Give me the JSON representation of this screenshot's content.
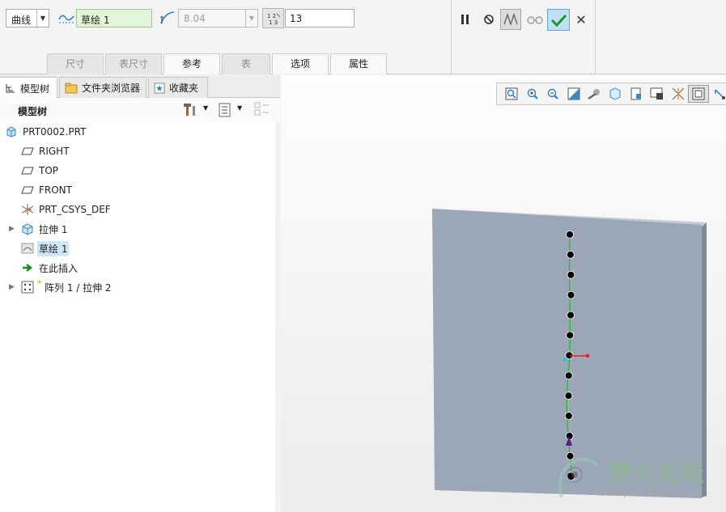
{
  "dashboard": {
    "type_dropdown": "曲线",
    "sketch_field": "草绘 1",
    "spacing_value": "8.04",
    "count_value": "13",
    "tabs": [
      {
        "label": "尺寸",
        "active": false
      },
      {
        "label": "表尺寸",
        "active": false
      },
      {
        "label": "参考",
        "active": true
      },
      {
        "label": "表",
        "active": false
      },
      {
        "label": "选项",
        "active": true
      },
      {
        "label": "属性",
        "active": true
      }
    ],
    "controls": [
      "pause-icon",
      "cancel-preview-icon",
      "verify-icon",
      "glasses-icon",
      "ok-check-icon",
      "close-icon"
    ]
  },
  "navigator": {
    "tabs": [
      {
        "label": "模型树"
      },
      {
        "label": "文件夹浏览器"
      },
      {
        "label": "收藏夹"
      }
    ],
    "tree_title": "模型树",
    "items": [
      {
        "label": "PRT0002.PRT",
        "icon": "part-icon",
        "indent": 0,
        "expander": false
      },
      {
        "label": "RIGHT",
        "icon": "datum-plane-icon",
        "indent": 1,
        "expander": false
      },
      {
        "label": "TOP",
        "icon": "datum-plane-icon",
        "indent": 1,
        "expander": false
      },
      {
        "label": "FRONT",
        "icon": "datum-plane-icon",
        "indent": 1,
        "expander": false
      },
      {
        "label": "PRT_CSYS_DEF",
        "icon": "csys-icon",
        "indent": 1,
        "expander": false
      },
      {
        "label": "拉伸 1",
        "icon": "extrude-icon",
        "indent": 1,
        "expander": true
      },
      {
        "label": "草绘 1",
        "icon": "sketch-icon",
        "indent": 1,
        "expander": false,
        "selected": true
      },
      {
        "label": "在此插入",
        "icon": "insert-here-icon",
        "indent": 1,
        "expander": false
      },
      {
        "label": "阵列 1 / 拉伸 2",
        "icon": "pattern-icon",
        "indent": 1,
        "expander": true
      }
    ]
  },
  "graphics": {
    "toolbar_icons": [
      "refit-icon",
      "zoom-in-icon",
      "zoom-out-icon",
      "repaint-icon",
      "display-style-icon",
      "saved-views-icon",
      "view-manager-icon",
      "perspective-icon",
      "datum-display-icon",
      "annotation-icon",
      "spin-center-icon"
    ],
    "pattern_member_count": 13,
    "colors": {
      "plate": "#9ba7b6",
      "plate_side": "#7e8896",
      "curve": "#1ec41e",
      "point": "#000000"
    }
  },
  "watermark": {
    "text": "野火论坛",
    "url": "www.proewildfire.cn"
  }
}
